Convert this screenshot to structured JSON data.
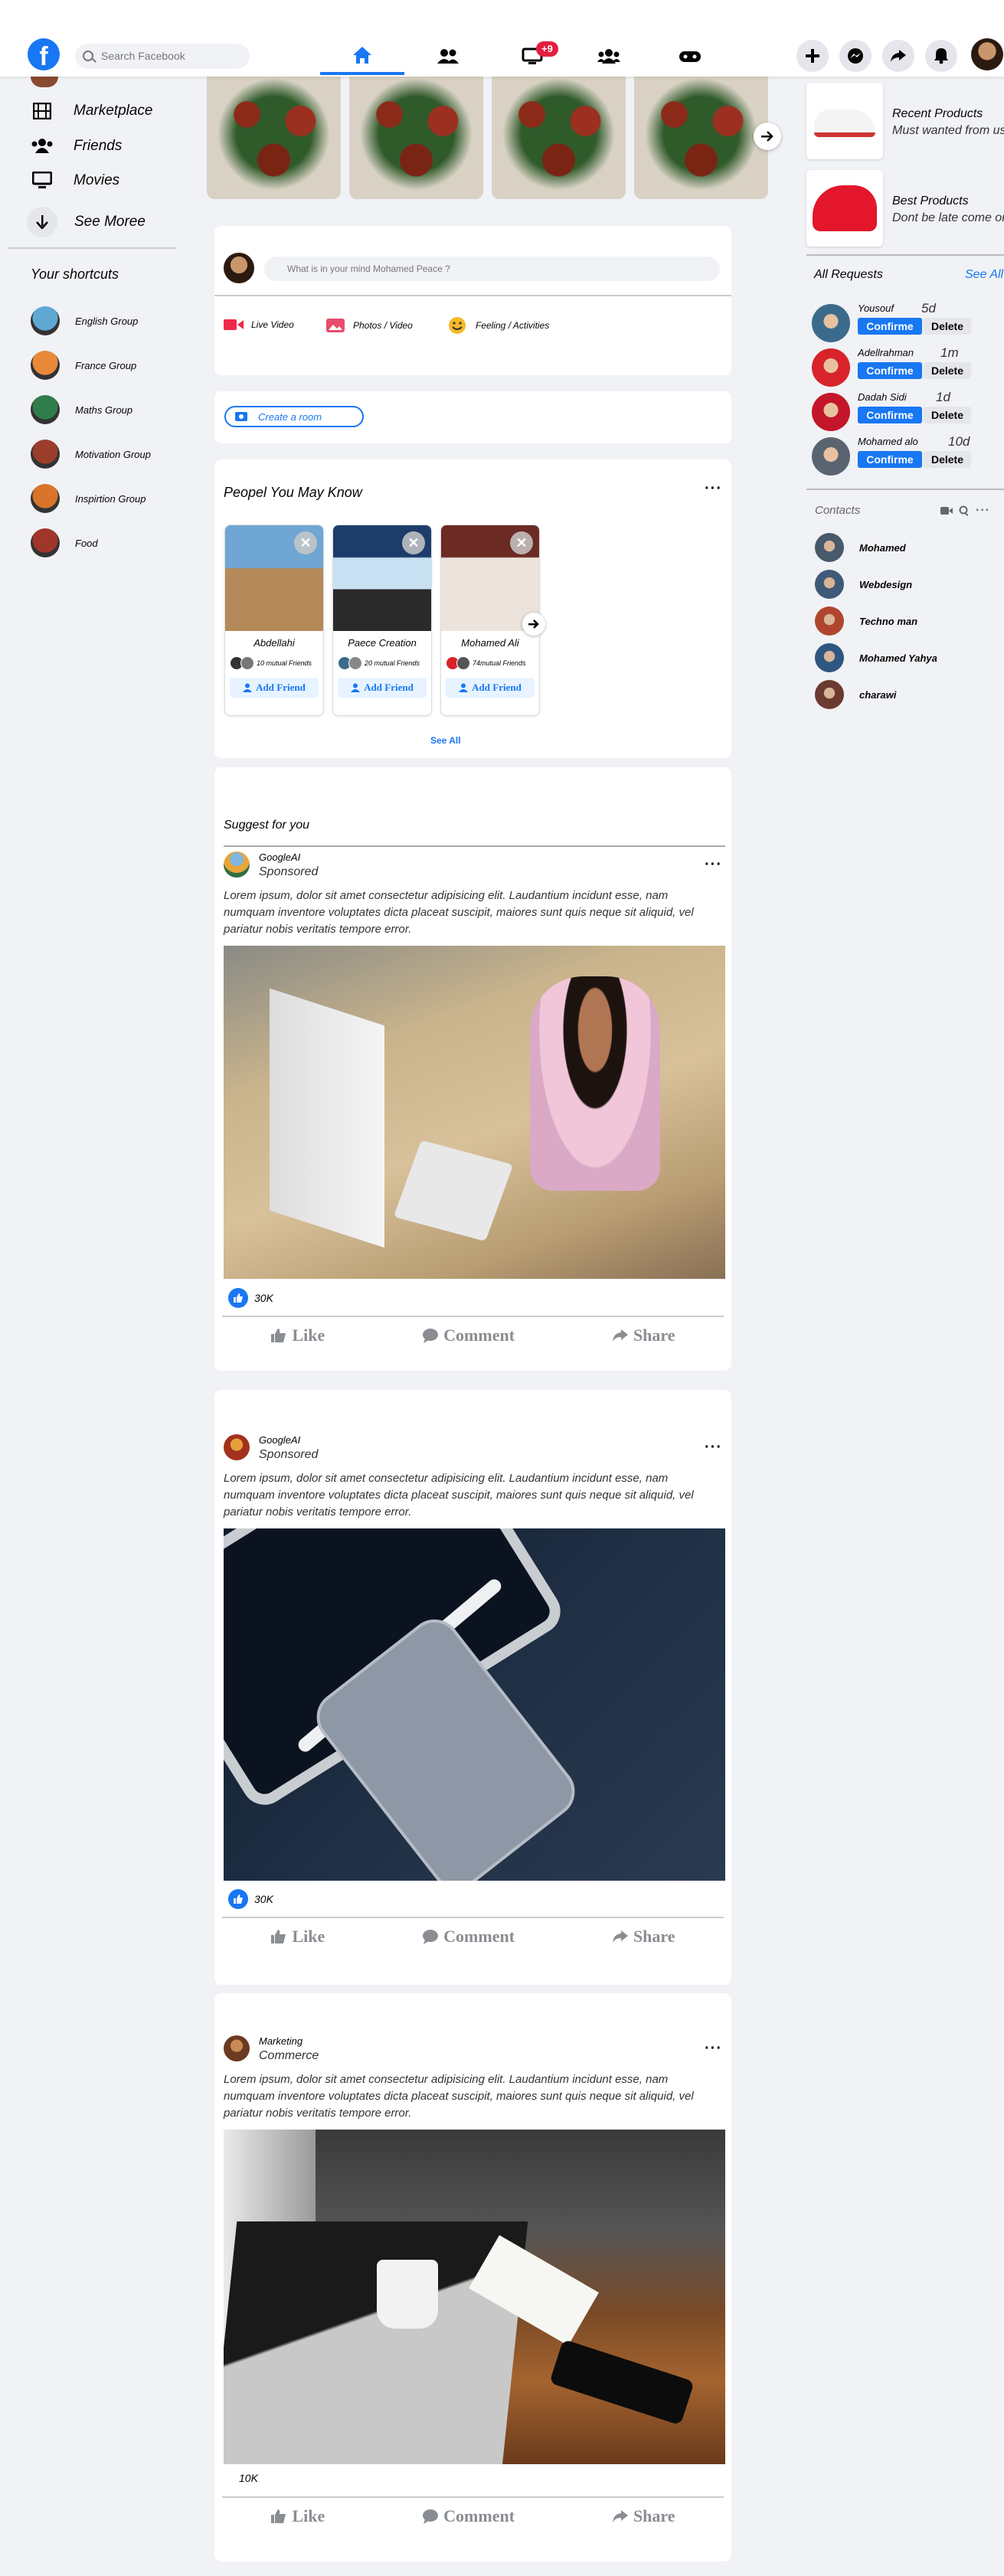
{
  "header": {
    "search_placeholder": "Search Facebook",
    "notification_badge": "+9",
    "logo_letter": "f"
  },
  "sidebar": {
    "items": [
      {
        "label": "Marketplace",
        "icon": "film-icon"
      },
      {
        "label": "Friends",
        "icon": "users-icon"
      },
      {
        "label": "Movies",
        "icon": "monitor-icon"
      },
      {
        "label": "See Moree",
        "icon": "arrow-down-icon"
      }
    ],
    "shortcuts_title": "Your shortcuts",
    "shortcuts": [
      {
        "label": "English Group",
        "color": "#5fa8d3"
      },
      {
        "label": "France Group",
        "color": "#e98a3a"
      },
      {
        "label": "Maths Group",
        "color": "#2f7d4a"
      },
      {
        "label": "Motivation Group",
        "color": "#9b3d2b"
      },
      {
        "label": "Inspirtion Group",
        "color": "#d8752a"
      },
      {
        "label": "Food",
        "color": "#a0352a"
      }
    ]
  },
  "composer": {
    "placeholder": "What is in your mind Mohamed Peace ?",
    "actions": [
      "Live Video",
      "Photos / Video",
      "Feeling / Activities"
    ],
    "room_label": "Create a room"
  },
  "people": {
    "title": "Peopel You May Know",
    "cards": [
      {
        "name": "Abdellahi",
        "mutual": "10 mutual Friends",
        "button": "Add Friend"
      },
      {
        "name": "Paece Creation",
        "mutual": "20 mutual Friends",
        "button": "Add Friend"
      },
      {
        "name": "Mohamed Ali",
        "mutual": "74mutual Friends",
        "button": "Add Friend"
      }
    ],
    "see_all": "See All"
  },
  "suggest_title": "Suggest for you",
  "lorem": "Lorem ipsum, dolor sit amet consectetur adipisicing elit. Laudantium incidunt esse, nam numquam inventore voluptates dicta placeat suscipit, maiores sunt quis neque sit aliquid, vel pariatur nobis veritatis tempore error.",
  "posts": [
    {
      "author": "GoogleAI",
      "sub": "Sponsored",
      "likes": "30K"
    },
    {
      "author": "GoogleAI",
      "sub": "Sponsored",
      "likes": "30K"
    },
    {
      "author": "Marketing",
      "sub": "Commerce",
      "likes": "10K"
    }
  ],
  "post_actions": {
    "like": "Like",
    "comment": "Comment",
    "share": "Share"
  },
  "right": {
    "products": [
      {
        "title": "Recent Products",
        "desc": "Must wanted from us"
      },
      {
        "title": "Best Products",
        "desc": "Dont be late come on"
      }
    ],
    "requests_title": "All Requests",
    "requests_see_all": "See All",
    "requests": [
      {
        "name": "Yousouf",
        "time": "5d",
        "color": "#3b6b8c"
      },
      {
        "name": "Adellrahman",
        "time": "1m",
        "color": "#d8232a"
      },
      {
        "name": "Dadah Sidi",
        "time": "1d",
        "color": "#c4162a"
      },
      {
        "name": "Mohamed alo",
        "time": "10d",
        "color": "#5a6470"
      }
    ],
    "confirm": "Confirme",
    "delete": "Delete",
    "contacts_title": "Contacts",
    "contacts": [
      {
        "name": "Mohamed",
        "color": "#47596b"
      },
      {
        "name": "Webdesign",
        "color": "#3f5a78"
      },
      {
        "name": "Techno man",
        "color": "#b0452f"
      },
      {
        "name": "Mohamed Yahya",
        "color": "#2f5680"
      },
      {
        "name": "charawi",
        "color": "#6b3a30"
      }
    ]
  }
}
